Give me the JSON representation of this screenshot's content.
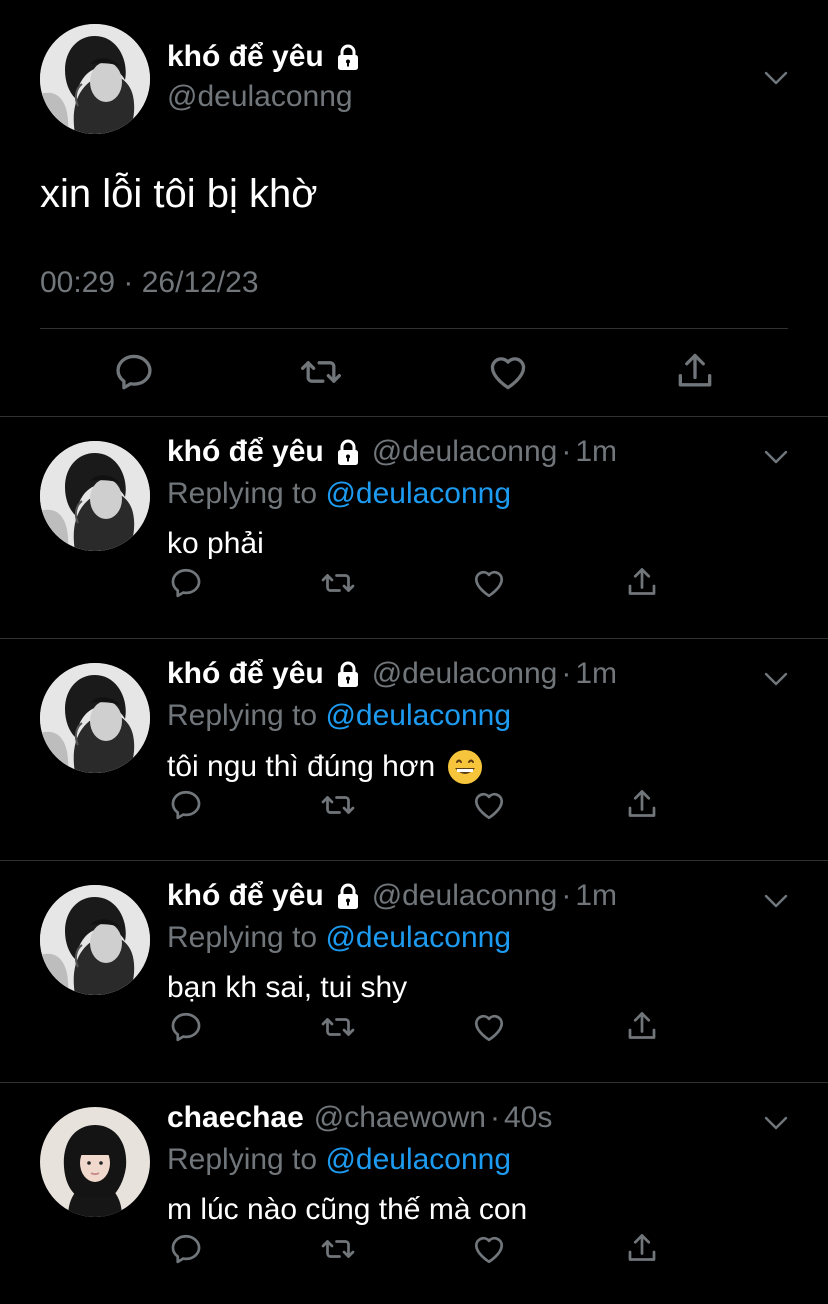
{
  "main_tweet": {
    "display_name": "khó để yêu",
    "handle": "@deulaconng",
    "text": "xin lỗi tôi bị khờ",
    "timestamp": "00:29 · 26/12/23"
  },
  "replies": [
    {
      "display_name": "khó để yêu",
      "handle": "@deulaconng",
      "dot": "·",
      "time": "1m",
      "replying_prefix": "Replying to",
      "replying_to": "@deulaconng",
      "text": "ko phải"
    },
    {
      "display_name": "khó để yêu",
      "handle": "@deulaconng",
      "dot": "·",
      "time": "1m",
      "replying_prefix": "Replying to",
      "replying_to": "@deulaconng",
      "text": "tôi ngu thì đúng hơn"
    },
    {
      "display_name": "khó để yêu",
      "handle": "@deulaconng",
      "dot": "·",
      "time": "1m",
      "replying_prefix": "Replying to",
      "replying_to": "@deulaconng",
      "text": "bạn kh sai, tui shy"
    },
    {
      "display_name": "chaechae",
      "handle": "@chaewown",
      "dot": "·",
      "time": "40s",
      "replying_prefix": "Replying to",
      "replying_to": "@deulaconng",
      "text": "m lúc nào cũng thế mà con"
    }
  ],
  "icons": {
    "lock": "lock-icon",
    "chevron": "chevron-down-icon",
    "reply": "reply-icon",
    "retweet": "retweet-icon",
    "like": "heart-icon",
    "share": "share-icon",
    "emoji": "grinning-face-icon"
  },
  "colors": {
    "background": "#000000",
    "text": "#ffffff",
    "secondary": "#71767b",
    "link": "#1d9bf0",
    "divider": "#2f3336"
  }
}
